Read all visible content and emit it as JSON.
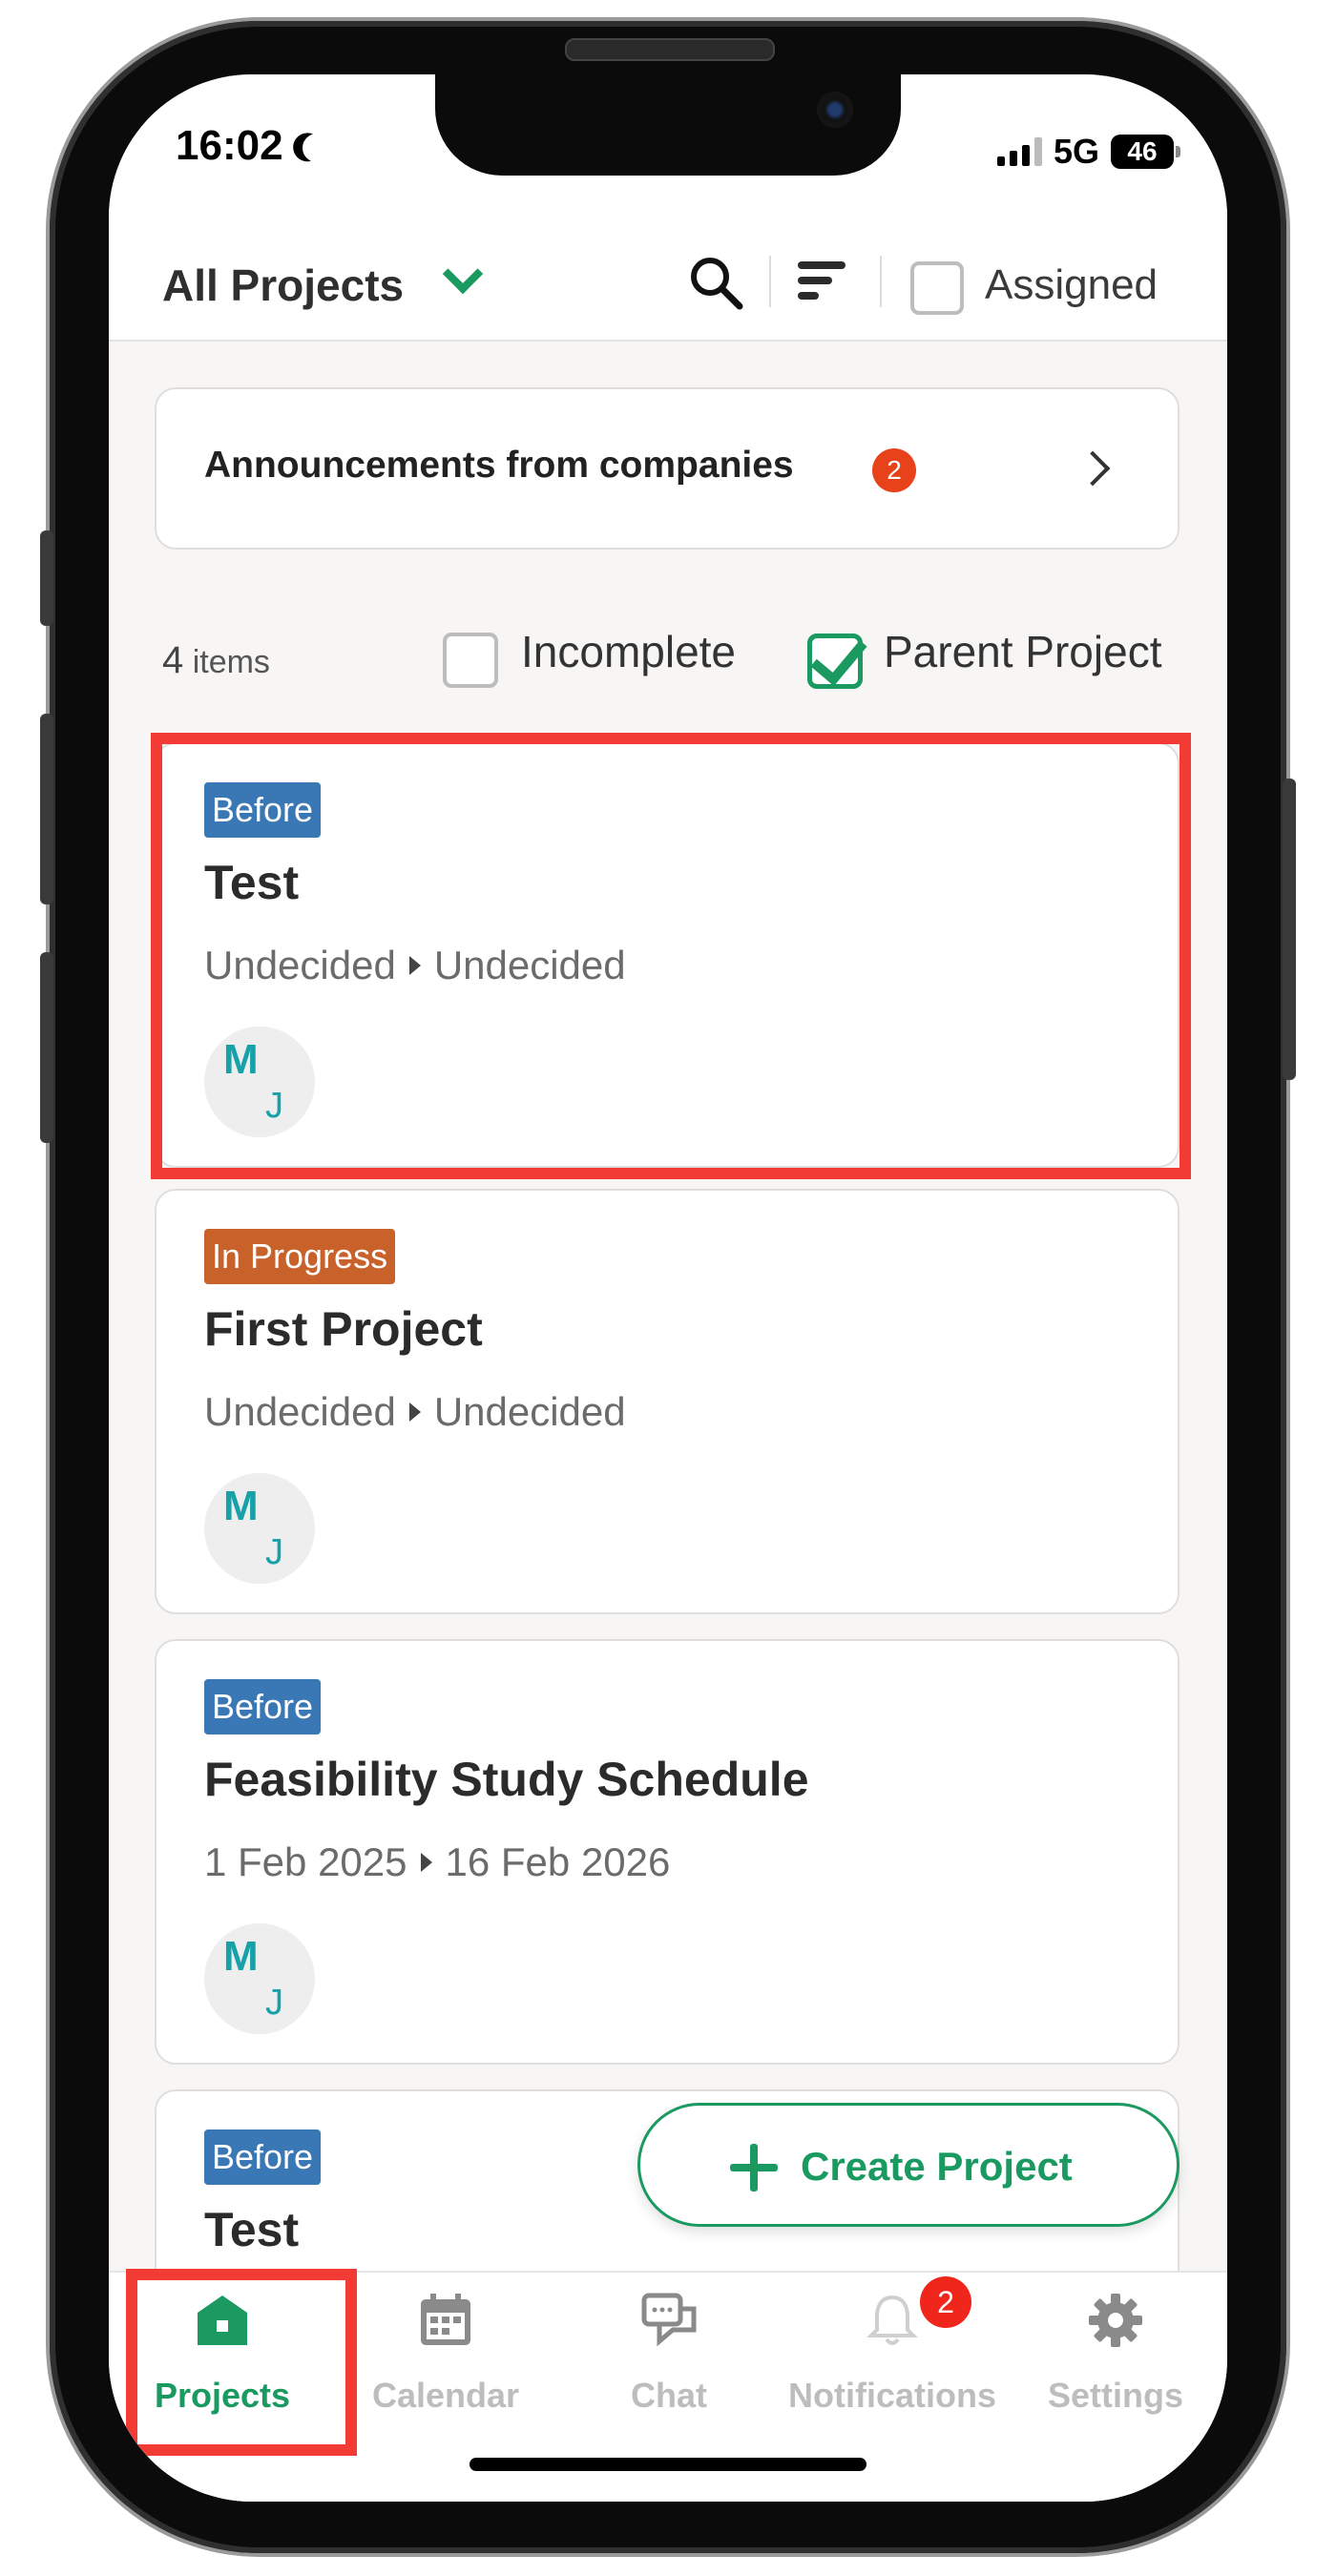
{
  "status_bar": {
    "time": "16:02",
    "network": "5G",
    "battery": "46"
  },
  "header": {
    "title": "All Projects",
    "assigned_label": "Assigned"
  },
  "announcements": {
    "label": "Announcements from companies",
    "badge_count": "2"
  },
  "filters": {
    "items_count": "4",
    "items_unit": "items",
    "incomplete_label": "Incomplete",
    "parent_project_label": "Parent Project",
    "incomplete_checked": false,
    "parent_project_checked": true
  },
  "projects": [
    {
      "status": "Before",
      "title": "Test",
      "start": "Undecided",
      "end": "Undecided",
      "avatar_initial_1": "M",
      "avatar_initial_2": "J"
    },
    {
      "status": "In Progress",
      "title": "First Project",
      "start": "Undecided",
      "end": "Undecided",
      "avatar_initial_1": "M",
      "avatar_initial_2": "J"
    },
    {
      "status": "Before",
      "title": "Feasibility Study Schedule",
      "start": "1 Feb 2025",
      "end": "16 Feb 2026",
      "avatar_initial_1": "M",
      "avatar_initial_2": "J"
    },
    {
      "status": "Before",
      "title": "Test"
    }
  ],
  "fab": {
    "label": "Create Project"
  },
  "tabs": [
    {
      "label": "Projects",
      "icon": "home-icon",
      "active": true
    },
    {
      "label": "Calendar",
      "icon": "calendar-icon"
    },
    {
      "label": "Chat",
      "icon": "chat-icon"
    },
    {
      "label": "Notifications",
      "icon": "bell-icon",
      "badge": "2"
    },
    {
      "label": "Settings",
      "icon": "gear-icon"
    }
  ],
  "colors": {
    "accent": "#1a9a60",
    "tag_before": "#3a78b5",
    "tag_in_progress": "#c9612a",
    "highlight": "#f23b35",
    "badge": "#e8421a"
  }
}
